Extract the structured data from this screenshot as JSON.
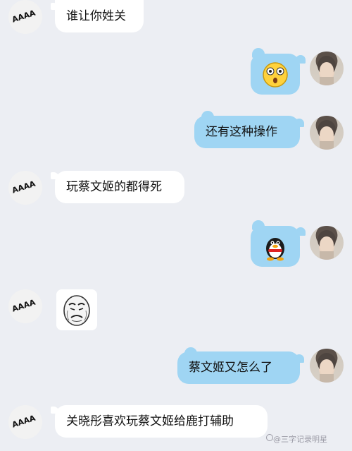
{
  "chat": {
    "messages": [
      {
        "sender": "other",
        "type": "text",
        "text": "谁让你姓关"
      },
      {
        "sender": "self",
        "type": "emoji",
        "emoji": "surprised-face-emoji"
      },
      {
        "sender": "self",
        "type": "text",
        "text": "还有这种操作"
      },
      {
        "sender": "other",
        "type": "text",
        "text": "玩蔡文姬的都得死"
      },
      {
        "sender": "self",
        "type": "emoji",
        "emoji": "qq-penguin-emoji"
      },
      {
        "sender": "other",
        "type": "sticker",
        "sticker": "crying-meme-face"
      },
      {
        "sender": "self",
        "type": "text",
        "text": "蔡文姬又怎么了"
      },
      {
        "sender": "other",
        "type": "text",
        "text": "关晓彤喜欢玩蔡文姬给鹿打辅助"
      }
    ],
    "other_avatar_text": "AAAA",
    "bubble_colors": {
      "incoming": "#ffffff",
      "outgoing": "#9fd5f3",
      "background": "#eceef3"
    }
  },
  "watermark": {
    "text": "@三字记录明星"
  }
}
